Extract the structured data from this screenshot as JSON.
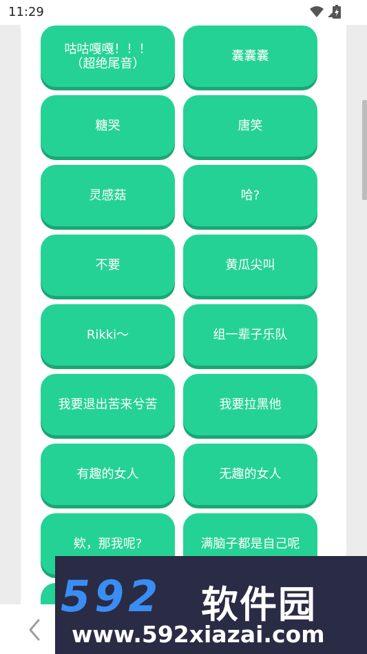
{
  "status_bar": {
    "time": "11:29"
  },
  "buttons": [
    {
      "label": "咕咕嘎嘎！！！\n（超绝尾音）"
    },
    {
      "label": "囊囊囊"
    },
    {
      "label": "糖哭"
    },
    {
      "label": "唐笑"
    },
    {
      "label": "灵感菇"
    },
    {
      "label": "哈?"
    },
    {
      "label": "不要"
    },
    {
      "label": "黄瓜尖叫"
    },
    {
      "label": "Rikki～"
    },
    {
      "label": "组一辈子乐队"
    },
    {
      "label": "我要退出苦来兮苦"
    },
    {
      "label": "我要拉黑他"
    },
    {
      "label": "有趣的女人"
    },
    {
      "label": "无趣的女人"
    },
    {
      "label": "欸，那我呢?"
    },
    {
      "label": "满脑子都是自己呢"
    },
    {
      "label": ""
    },
    {
      "label": ""
    }
  ],
  "watermark": {
    "logo_number": "592",
    "logo_text": "软件园",
    "url": "www.592xiazai.com"
  },
  "colors": {
    "button": "#25d295",
    "button_shadow": "#1aa775",
    "watermark_bg": "#2a2b45",
    "watermark_accent": "#3a8df5"
  }
}
